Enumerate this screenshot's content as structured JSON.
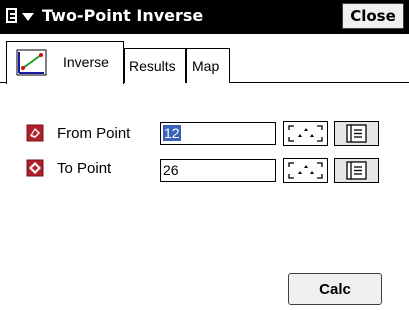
{
  "window": {
    "title": "Two-Point Inverse",
    "close_label": "Close"
  },
  "tabs": [
    {
      "label": "Inverse",
      "active": true
    },
    {
      "label": "Results",
      "active": false
    },
    {
      "label": "Map",
      "active": false
    }
  ],
  "form": {
    "from_point": {
      "label": "From Point",
      "value": "12",
      "selected": true
    },
    "to_point": {
      "label": "To Point",
      "value": "26",
      "selected": false
    }
  },
  "calc_label": "Calc",
  "colors": {
    "titlebar": "#000000",
    "selection": "#3a63b6",
    "point_icon": "#b0202a"
  }
}
